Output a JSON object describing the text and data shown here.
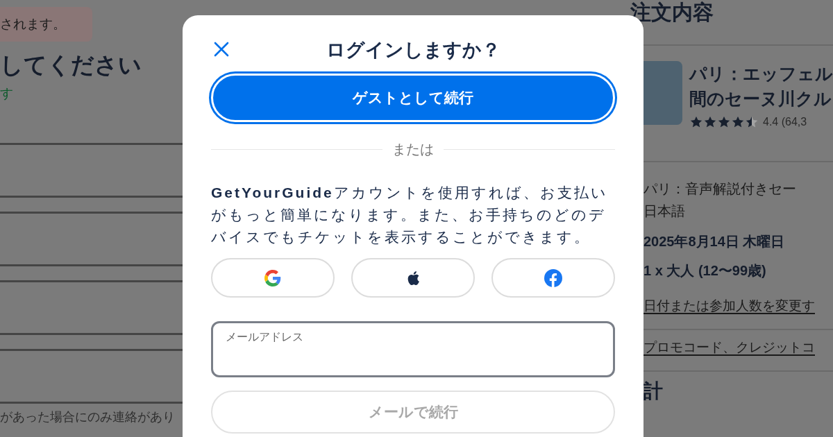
{
  "background_page": {
    "notice": "されます。",
    "heading": "してください",
    "note": "す",
    "fields": [
      {
        "kind": "field"
      },
      {
        "kind": "field"
      },
      {
        "kind": "field"
      },
      {
        "kind": "field"
      }
    ],
    "footer_text": "があった場合にのみ連絡があり"
  },
  "order_summary": {
    "title": "注文内容",
    "product": {
      "title_lines": [
        "パリ：エッフェル",
        "間のセーヌ川クル"
      ],
      "stars": 4.5,
      "rating": "4.4 (64,3"
    },
    "option": "パリ：音声解説付きセー",
    "language": "日本語",
    "date": "2025年8月14日 木曜日",
    "participants": "1 x 大人 (12〜99歳)",
    "change_link": "日付または参加人数を変更す",
    "promo_link": "プロモコード、クレジットコ",
    "total_heading": "計"
  },
  "dialog": {
    "title": "ログインしますか？",
    "guest_button": "ゲストとして続行",
    "divider": "または",
    "description": "**GetYourGuide**アカウントを使用すれば、お支払いがもっと簡単になります。また、お手持ちのどのデバイスでもチケットを表示することができます。",
    "social_buttons": [
      {
        "kind": "google"
      },
      {
        "kind": "apple"
      },
      {
        "kind": "facebook"
      }
    ],
    "email_field": {
      "placeholder": "メールアドレス"
    },
    "continue_button": {
      "label": "メールで続行",
      "disabled": true
    }
  }
}
